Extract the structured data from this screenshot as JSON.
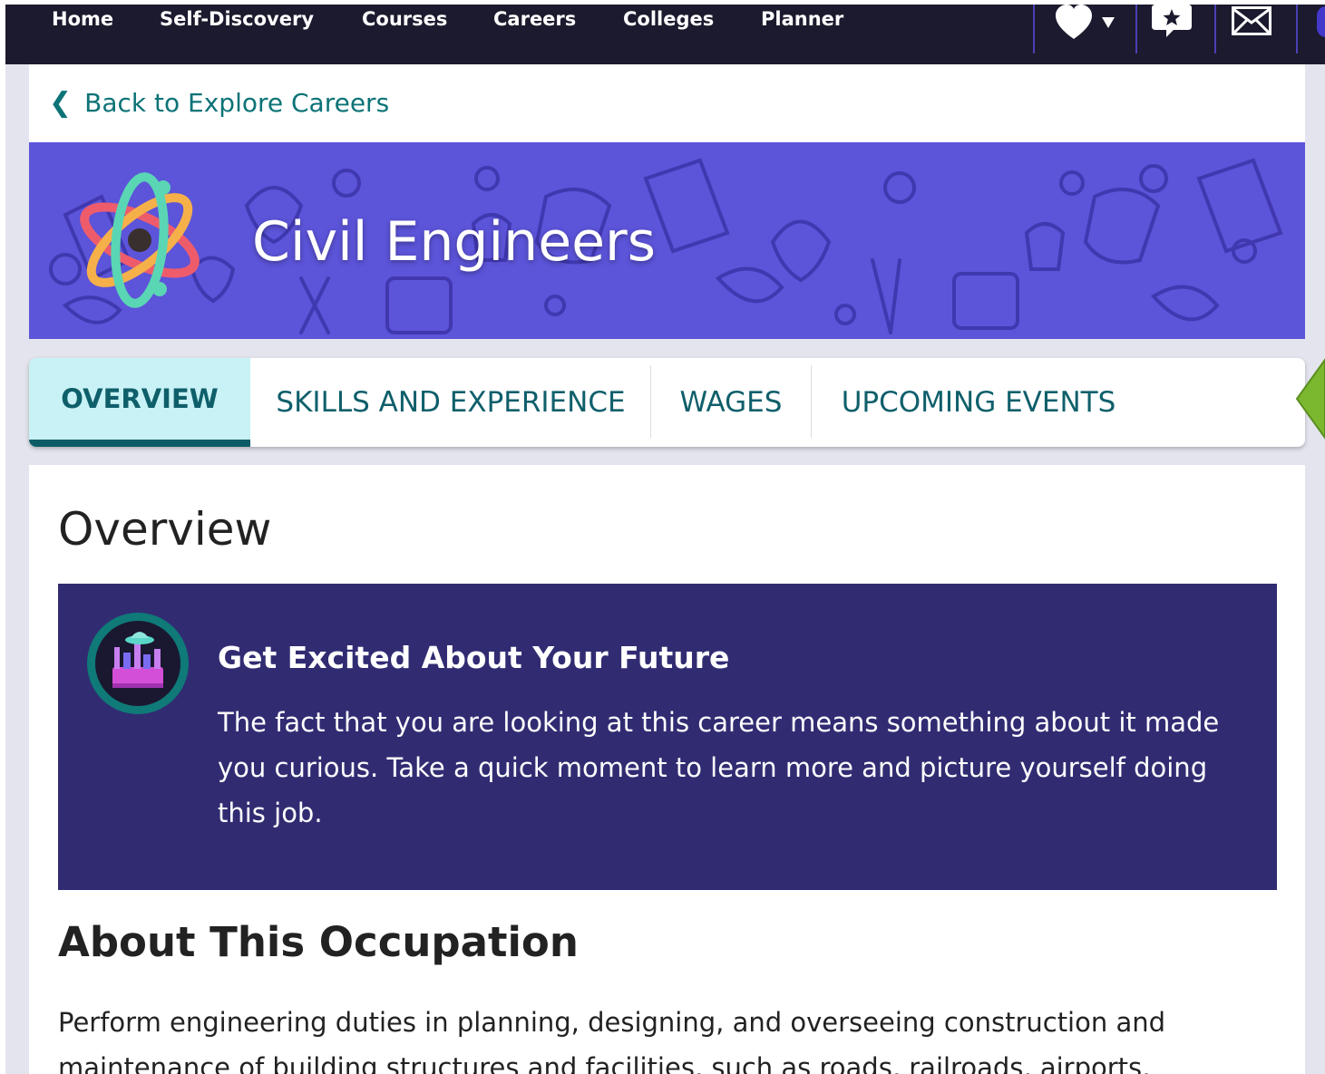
{
  "nav": {
    "items": [
      {
        "label": "Home"
      },
      {
        "label": "Self-Discovery"
      },
      {
        "label": "Courses"
      },
      {
        "label": "Careers"
      },
      {
        "label": "Colleges"
      },
      {
        "label": "Planner"
      }
    ],
    "icons": [
      "heart-dropdown-icon",
      "favorites-star-icon",
      "mail-icon",
      "avatar-icon"
    ]
  },
  "back_link": {
    "label": "Back to Explore Careers"
  },
  "banner": {
    "title": "Civil Engineers",
    "logo": "atom-icon"
  },
  "tabs": [
    {
      "label": "OVERVIEW",
      "active": true
    },
    {
      "label": "SKILLS AND EXPERIENCE",
      "active": false
    },
    {
      "label": "WAGES",
      "active": false
    },
    {
      "label": "UPCOMING EVENTS",
      "active": false
    }
  ],
  "overview": {
    "heading": "Overview",
    "callout": {
      "icon": "future-city-icon",
      "title": "Get Excited About Your Future",
      "body": "The fact that you are looking at this career means something about it made you curious. Take a quick moment to learn more and picture yourself doing this job."
    },
    "about_heading": "About This Occupation",
    "about_text": "Perform engineering duties in planning, designing, and overseeing construction and maintenance of building structures and facilities, such as roads, railroads, airports,"
  },
  "colors": {
    "nav_bg": "#1b1a2e",
    "banner_bg": "#5c54d9",
    "accent_teal": "#0d7377",
    "active_tab_bg": "#c8f2f5",
    "callout_bg": "#312c72",
    "indicator_green": "#7cb82f"
  }
}
